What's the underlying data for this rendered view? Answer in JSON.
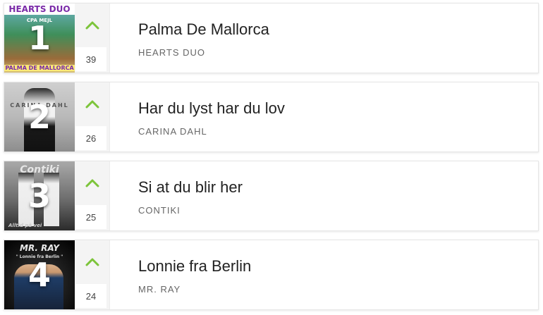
{
  "chart": {
    "entries": [
      {
        "rank": "1",
        "title": "Palma De Mallorca",
        "artist": "HEARTS DUO",
        "weeks": "39",
        "trend": "up",
        "cover_text_top": "HEARTS DUO",
        "cover_text_sub": "CPA MEJL",
        "cover_text_bottom": "PALMA DE MALLORCA"
      },
      {
        "rank": "2",
        "title": "Har du lyst har du lov",
        "artist": "CARINA DAHL",
        "weeks": "26",
        "trend": "up",
        "cover_text_top": "CARINA DAHL"
      },
      {
        "rank": "3",
        "title": "Si at du blir her",
        "artist": "CONTIKI",
        "weeks": "25",
        "trend": "up",
        "cover_text_top": "Contiki",
        "cover_text_bottom": "Alltid på vei"
      },
      {
        "rank": "4",
        "title": "Lonnie fra Berlin",
        "artist": "MR. RAY",
        "weeks": "24",
        "trend": "up",
        "cover_text_top": "MR. RAY",
        "cover_text_sub": "\" Lonnie fra Berlin \""
      }
    ]
  },
  "colors": {
    "trend_up": "#7cc43a",
    "title": "#222222",
    "artist": "#666666"
  },
  "icons": {
    "trend_up": "chevron-up-icon"
  }
}
